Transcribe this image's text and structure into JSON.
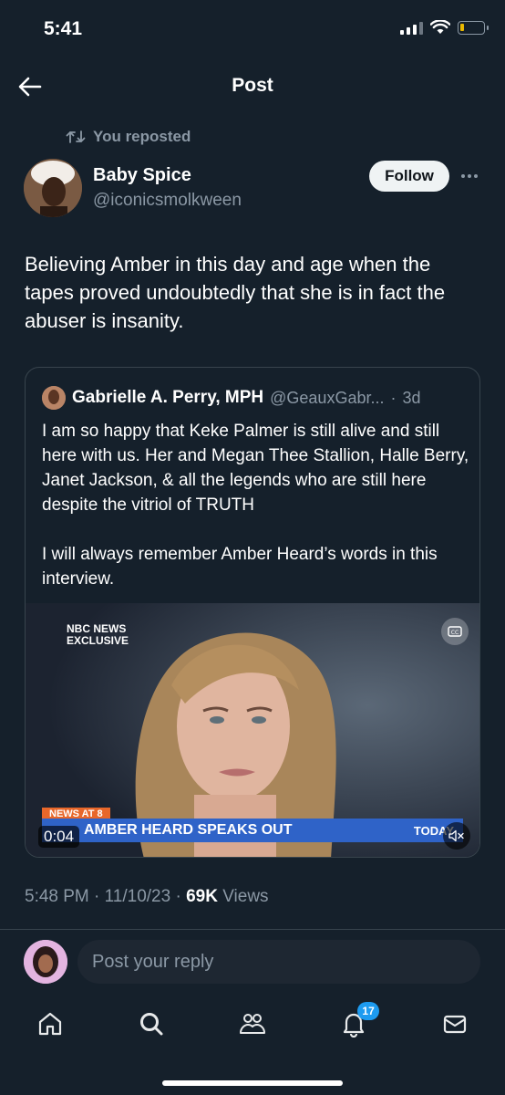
{
  "status_bar": {
    "time": "5:41"
  },
  "header": {
    "title": "Post"
  },
  "repost_label": "You reposted",
  "author": {
    "name": "Baby Spice",
    "handle": "@iconicsmolkween",
    "follow_label": "Follow"
  },
  "tweet_text": "Believing Amber in this day and age when the tapes proved undoubtedly that she is in fact the abuser is insanity.",
  "quoted": {
    "name": "Gabrielle A. Perry, MPH",
    "handle": "@GeauxGabr...",
    "separator": "·",
    "time": "3d",
    "text": "I am so happy that Keke Palmer is still alive and still here with us. Her and Megan Thee Stallion, Halle Berry, Janet Jackson, & all the legends who are still here despite the vitriol of TRUTH\n\nI will always remember Amber Heard’s words in this interview.",
    "video": {
      "nbc_line1": "NBC NEWS",
      "nbc_line2": "EXCLUSIVE",
      "news_at": "NEWS AT 8",
      "headline": "AMBER HEARD SPEAKS OUT",
      "network": "TODAY",
      "duration": "0:04"
    }
  },
  "meta": {
    "time": "5:48 PM · 11/10/23 · ",
    "views_count": "69K",
    "views_label": " Views"
  },
  "reply": {
    "placeholder": "Post your reply"
  },
  "tabbar": {
    "notifications_badge": "17"
  },
  "colors": {
    "background": "#15202b",
    "accent": "#1d9bf0",
    "secondary_text": "#8b98a5"
  }
}
